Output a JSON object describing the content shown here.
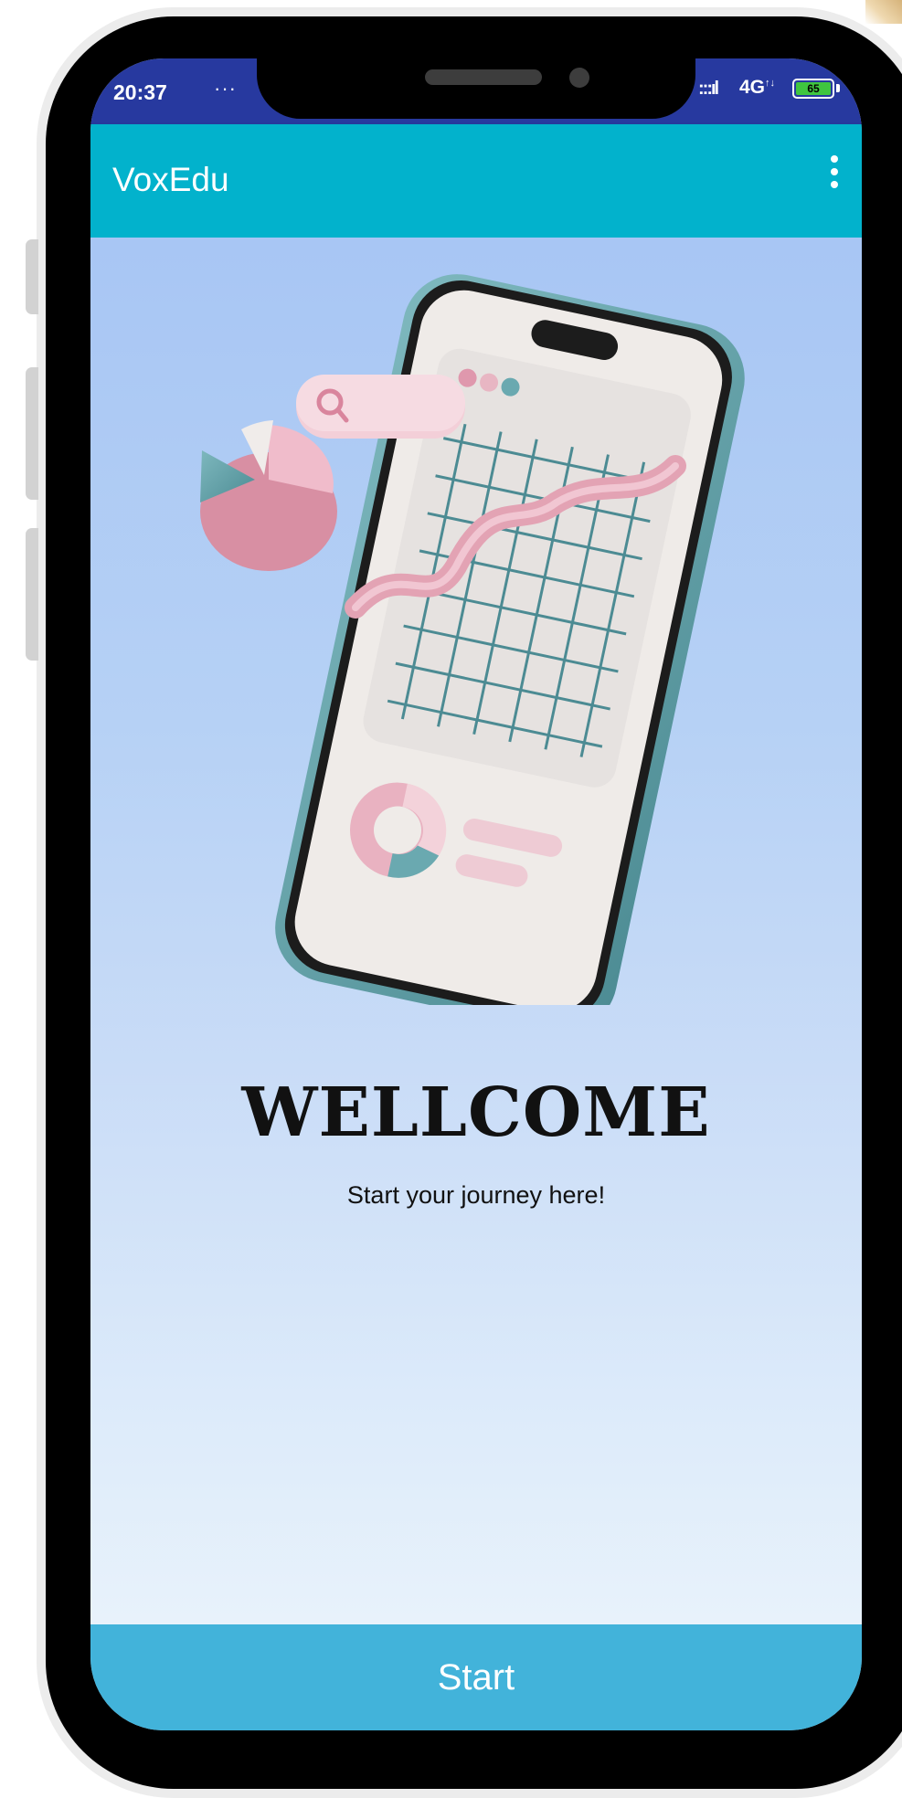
{
  "status_bar": {
    "time": "20:37",
    "notification_dots": "···",
    "signal_icon": "signal-bars-icon",
    "network": "4G",
    "network_arrows": "↑↓",
    "battery": "65"
  },
  "app_bar": {
    "title": "VoxEdu",
    "menu_icon": "more-vertical-icon"
  },
  "hero": {
    "illustration": "phone-with-charts-illustration"
  },
  "welcome": {
    "title": "WELLCOME",
    "subtitle": "Start your journey here!"
  },
  "start_button": {
    "label": "Start"
  },
  "colors": {
    "status_bar": "#27399f",
    "app_bar": "#02b2cc",
    "start_button": "#42b3da",
    "illustration_teal": "#5f9ea6",
    "illustration_pink": "#e3a3b4"
  }
}
